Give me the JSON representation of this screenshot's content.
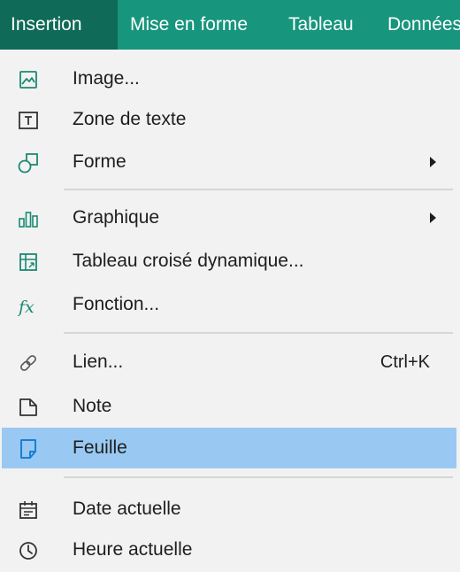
{
  "menubar": {
    "tabs": [
      {
        "label": "Insertion",
        "active": true
      },
      {
        "label": "Mise en forme"
      },
      {
        "label": "Tableau"
      },
      {
        "label": "Données"
      }
    ]
  },
  "dropdown": {
    "items": [
      {
        "label": "Image...",
        "icon": "image-icon"
      },
      {
        "label": "Zone de texte",
        "icon": "text-box-icon"
      },
      {
        "label": "Forme",
        "icon": "shape-icon",
        "has_submenu": true
      },
      {
        "label": "Graphique",
        "icon": "chart-icon",
        "has_submenu": true
      },
      {
        "label": "Tableau croisé dynamique...",
        "icon": "pivot-table-icon"
      },
      {
        "label": "Fonction...",
        "icon": "function-icon"
      },
      {
        "label": "Lien...",
        "icon": "link-icon",
        "shortcut": "Ctrl+K"
      },
      {
        "label": "Note",
        "icon": "note-icon"
      },
      {
        "label": "Feuille",
        "icon": "sheet-icon",
        "highlighted": true
      },
      {
        "label": "Date actuelle",
        "icon": "calendar-icon"
      },
      {
        "label": "Heure actuelle",
        "icon": "clock-icon"
      }
    ]
  },
  "colors": {
    "menubar_bg": "#17957d",
    "active_tab_bg": "#0f6a58",
    "menu_bg": "#f2f2f2",
    "highlight_bg": "#99c9f2",
    "icon_accent": "#1b8a72",
    "sheet_icon": "#1a7fd4"
  }
}
